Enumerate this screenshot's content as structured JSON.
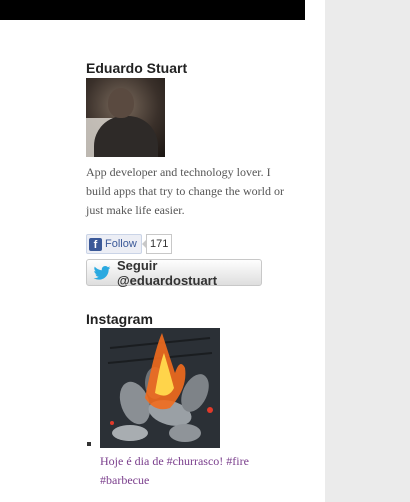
{
  "author": {
    "name": "Eduardo Stuart",
    "bio": "App developer and technology lover. I build apps that try to change the world or just make life easier."
  },
  "facebook": {
    "follow_label": "Follow",
    "count": "171"
  },
  "twitter": {
    "follow_label": "Seguir @eduardostuart"
  },
  "instagram": {
    "title": "Instagram",
    "caption": "Hoje é dia de #churrasco! #fire #barbecue"
  },
  "icons": {
    "facebook": "facebook-icon",
    "twitter": "twitter-bird-icon"
  },
  "colors": {
    "facebook_blue": "#3b5998",
    "twitter_blue": "#2aa9e0",
    "link_purple": "#7a3e8c"
  }
}
